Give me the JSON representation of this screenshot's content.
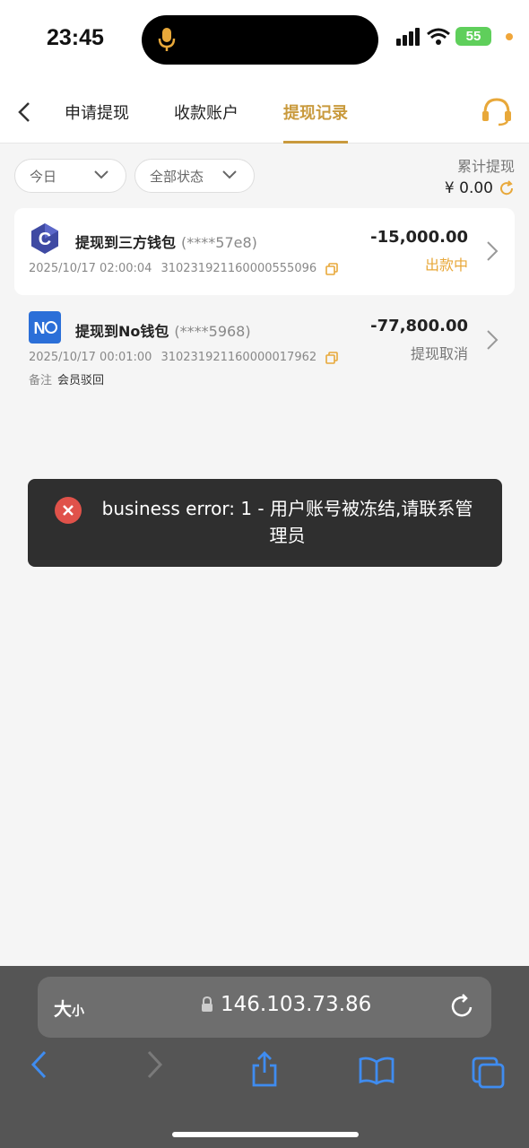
{
  "status_bar": {
    "time": "23:45",
    "battery": "55"
  },
  "nav": {
    "tabs": [
      {
        "label": "申请提现"
      },
      {
        "label": "收款账户"
      },
      {
        "label": "提现记录"
      }
    ]
  },
  "filters": {
    "date": "今日",
    "status": "全部状态",
    "total_label": "累计提现",
    "total_amount": "¥ 0.00"
  },
  "records": [
    {
      "title": "提现到三方钱包",
      "masked": "(****57e8)",
      "datetime": "2025/10/17 02:00:04",
      "order_id": "310231921160000555096",
      "amount": "-15,000.00",
      "status": "出款中",
      "status_color": "#e8a83a",
      "logo": "C"
    },
    {
      "title": "提现到No钱包",
      "masked": "(****5968)",
      "datetime": "2025/10/17 00:01:00",
      "order_id": "310231921160000017962",
      "amount": "-77,800.00",
      "status": "提现取消",
      "status_color": "#777777",
      "logo": "N",
      "remark_label": "备注",
      "remark_value": "会员驳回"
    }
  ],
  "toast": {
    "message": "business error: 1 - 用户账号被冻结,请联系管理员"
  },
  "browser": {
    "text_size": "大",
    "text_size_small": "小",
    "url": "146.103.73.86"
  },
  "colors": {
    "accent": "#c99a3d",
    "processing": "#e8a83a"
  }
}
